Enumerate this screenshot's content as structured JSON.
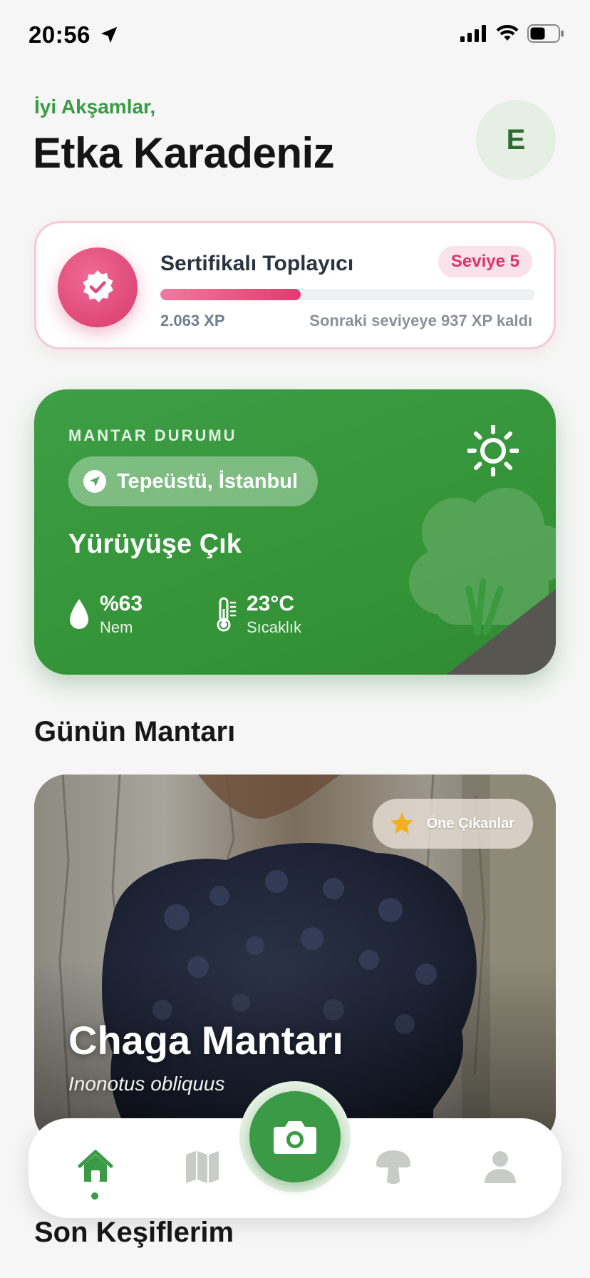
{
  "status_bar": {
    "time": "20:56",
    "icons": [
      "location-arrow-icon",
      "signal-icon",
      "wifi-icon",
      "battery-icon"
    ]
  },
  "header": {
    "greeting": "İyi Akşamlar,",
    "user_name": "Etka Karadeniz",
    "avatar_initial": "E"
  },
  "level_card": {
    "title": "Sertifikalı Toplayıcı",
    "level_label": "Seviye 5",
    "xp_current": "2.063 XP",
    "xp_remaining": "Sonraki seviyeye 937 XP kaldı",
    "progress_fraction": 0.375,
    "badge_icon": "verified-badge-icon",
    "accent_color": "#e03b71"
  },
  "weather_card": {
    "eyebrow": "MANTAR DURUMU",
    "location": "Tepeüstü, İstanbul",
    "status": "Yürüyüşe Çık",
    "humidity_value": "%63",
    "humidity_label": "Nem",
    "temperature_value": "23°C",
    "temperature_label": "Sıcaklık",
    "weather_icon": "sun-icon",
    "accent_color": "#3b9a45"
  },
  "mushroom_of_day": {
    "section_title": "Günün Mantarı",
    "featured_label": "Öne Çıkanlar",
    "name": "Chaga Mantarı",
    "latin_name": "Inonotus obliquus"
  },
  "recent": {
    "section_title": "Son Keşiflerim"
  },
  "tab_bar": {
    "items": [
      "home-icon",
      "map-icon",
      "camera-icon",
      "mushroom-icon",
      "profile-icon"
    ],
    "active": "home-icon"
  }
}
